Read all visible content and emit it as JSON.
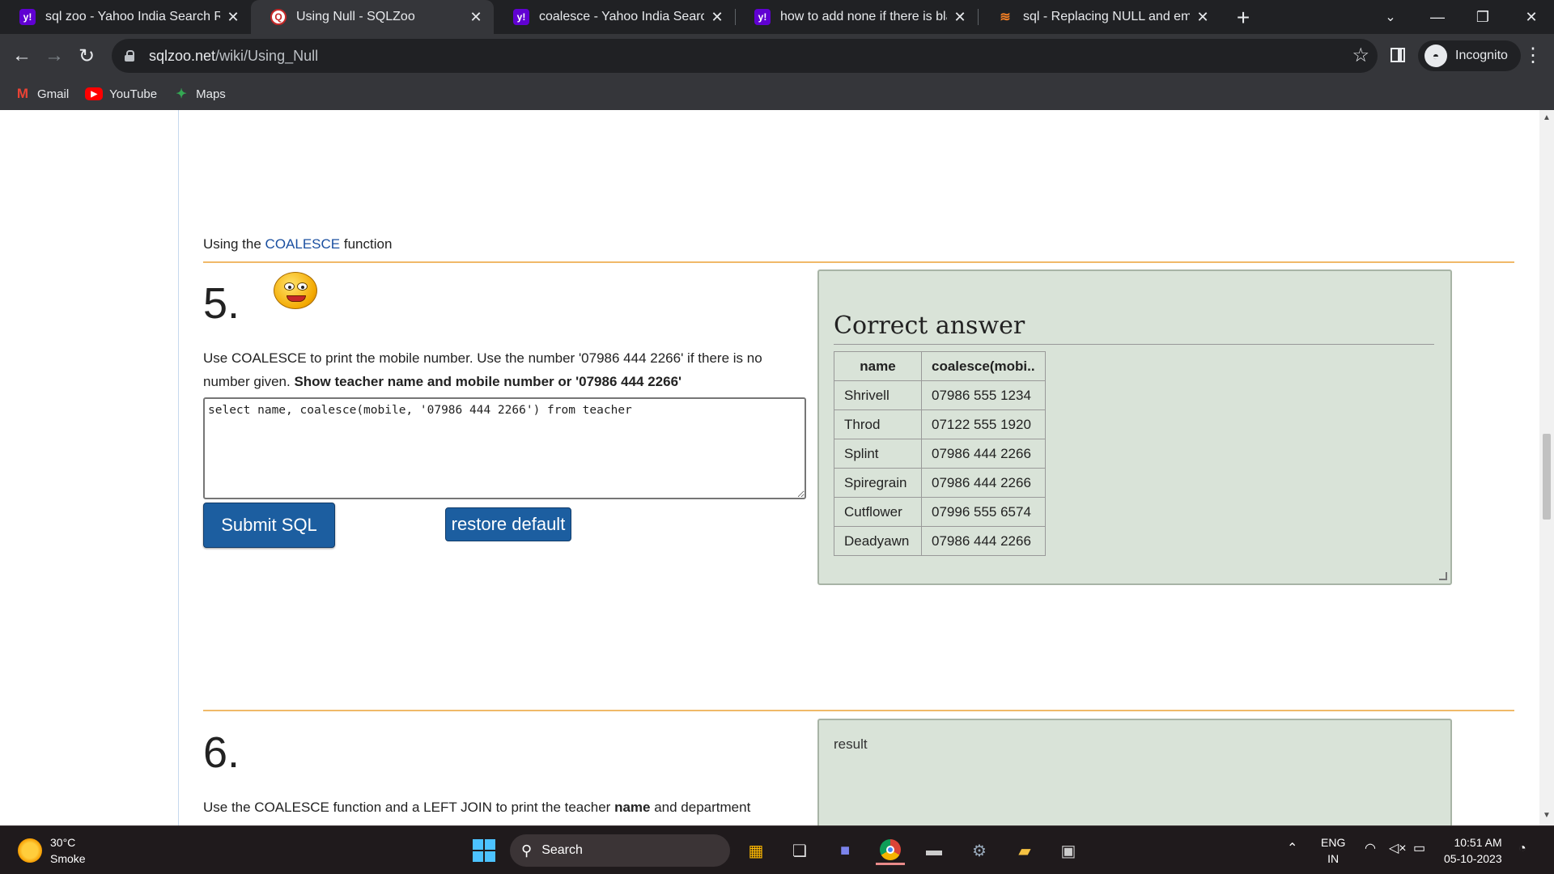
{
  "tabs": [
    {
      "title": "sql zoo - Yahoo India Search Res",
      "icon": "yahoo-icon",
      "active": false
    },
    {
      "title": "Using Null - SQLZoo",
      "icon": "sqlzoo-icon",
      "active": true
    },
    {
      "title": "coalesce - Yahoo India Search Re",
      "icon": "yahoo-icon",
      "active": false
    },
    {
      "title": "how to add none if there is blan",
      "icon": "yahoo-icon",
      "active": false
    },
    {
      "title": "sql - Replacing NULL and empty",
      "icon": "stackoverflow-icon",
      "active": false
    }
  ],
  "address": {
    "host": "sqlzoo.net",
    "path": "/wiki/Using_Null"
  },
  "profile_label": "Incognito",
  "bookmarks": [
    {
      "label": "Gmail",
      "icon": "gmail-icon"
    },
    {
      "label": "YouTube",
      "icon": "youtube-icon"
    },
    {
      "label": "Maps",
      "icon": "maps-icon"
    }
  ],
  "section": {
    "intro_prefix": "Using the ",
    "intro_link": "COALESCE",
    "intro_suffix": " function"
  },
  "question5": {
    "number": "5.",
    "text_plain": "Use COALESCE to print the mobile number. Use the number '07986 444 2266' if there is no number given. ",
    "text_bold": "Show teacher name and mobile number or '07986 444 2266'",
    "sql": "select name, coalesce(mobile, '07986 444 2266') from teacher",
    "submit_label": "Submit SQL",
    "restore_label": "restore default"
  },
  "answer": {
    "heading": "Correct answer",
    "columns": [
      "name",
      "coalesce(mobi.."
    ],
    "rows": [
      [
        "Shrivell",
        "07986 555 1234"
      ],
      [
        "Throd",
        "07122 555 1920"
      ],
      [
        "Splint",
        "07986 444 2266"
      ],
      [
        "Spiregrain",
        "07986 444 2266"
      ],
      [
        "Cutflower",
        "07996 555 6574"
      ],
      [
        "Deadyawn",
        "07986 444 2266"
      ]
    ]
  },
  "question6": {
    "number": "6.",
    "text_prefix": "Use the COALESCE function and a LEFT JOIN to print the teacher ",
    "text_bold": "name",
    "text_suffix": " and department",
    "result_label": "result"
  },
  "taskbar": {
    "temperature": "30°C",
    "weather": "Smoke",
    "search_label": "Search",
    "lang_line1": "ENG",
    "lang_line2": "IN",
    "time": "10:51 AM",
    "date": "05-10-2023"
  },
  "colors": {
    "accent_link": "#1a4fa0",
    "button_blue": "#1c5ea0",
    "answer_bg": "#d9e3d8",
    "divider": "#f0b969"
  }
}
